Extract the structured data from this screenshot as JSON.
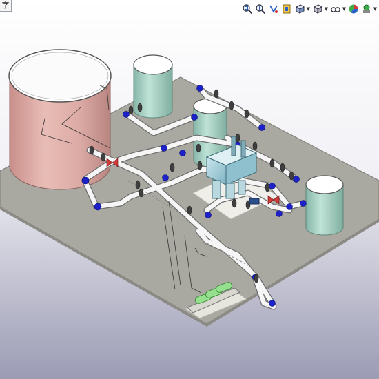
{
  "window": {
    "corner_tab_label": "字"
  },
  "view_toolbar": {
    "buttons": [
      {
        "icon": "zoom-to-fit-icon",
        "has_dropdown": false
      },
      {
        "icon": "zoom-to-area-icon",
        "has_dropdown": false
      },
      {
        "icon": "previous-view-icon",
        "has_dropdown": false
      },
      {
        "icon": "section-view-icon",
        "has_dropdown": false
      },
      {
        "icon": "view-orientation-icon",
        "has_dropdown": true
      },
      {
        "icon": "display-style-icon",
        "has_dropdown": true
      },
      {
        "icon": "hide-show-items-icon",
        "has_dropdown": true
      },
      {
        "icon": "edit-appearance-icon",
        "has_dropdown": false
      },
      {
        "icon": "apply-scene-icon",
        "has_dropdown": true
      }
    ]
  },
  "colors": {
    "floor": "#a9a8a1",
    "big_tank": "#e4b0aa",
    "small_tank": "#a8d4c6",
    "pipe": "#f2f2f2",
    "flange": "#444444",
    "elbow": "#1d22c8",
    "valve": "#d23a3a",
    "pump": "#9ccad6",
    "cartridge": "#94e08e"
  }
}
